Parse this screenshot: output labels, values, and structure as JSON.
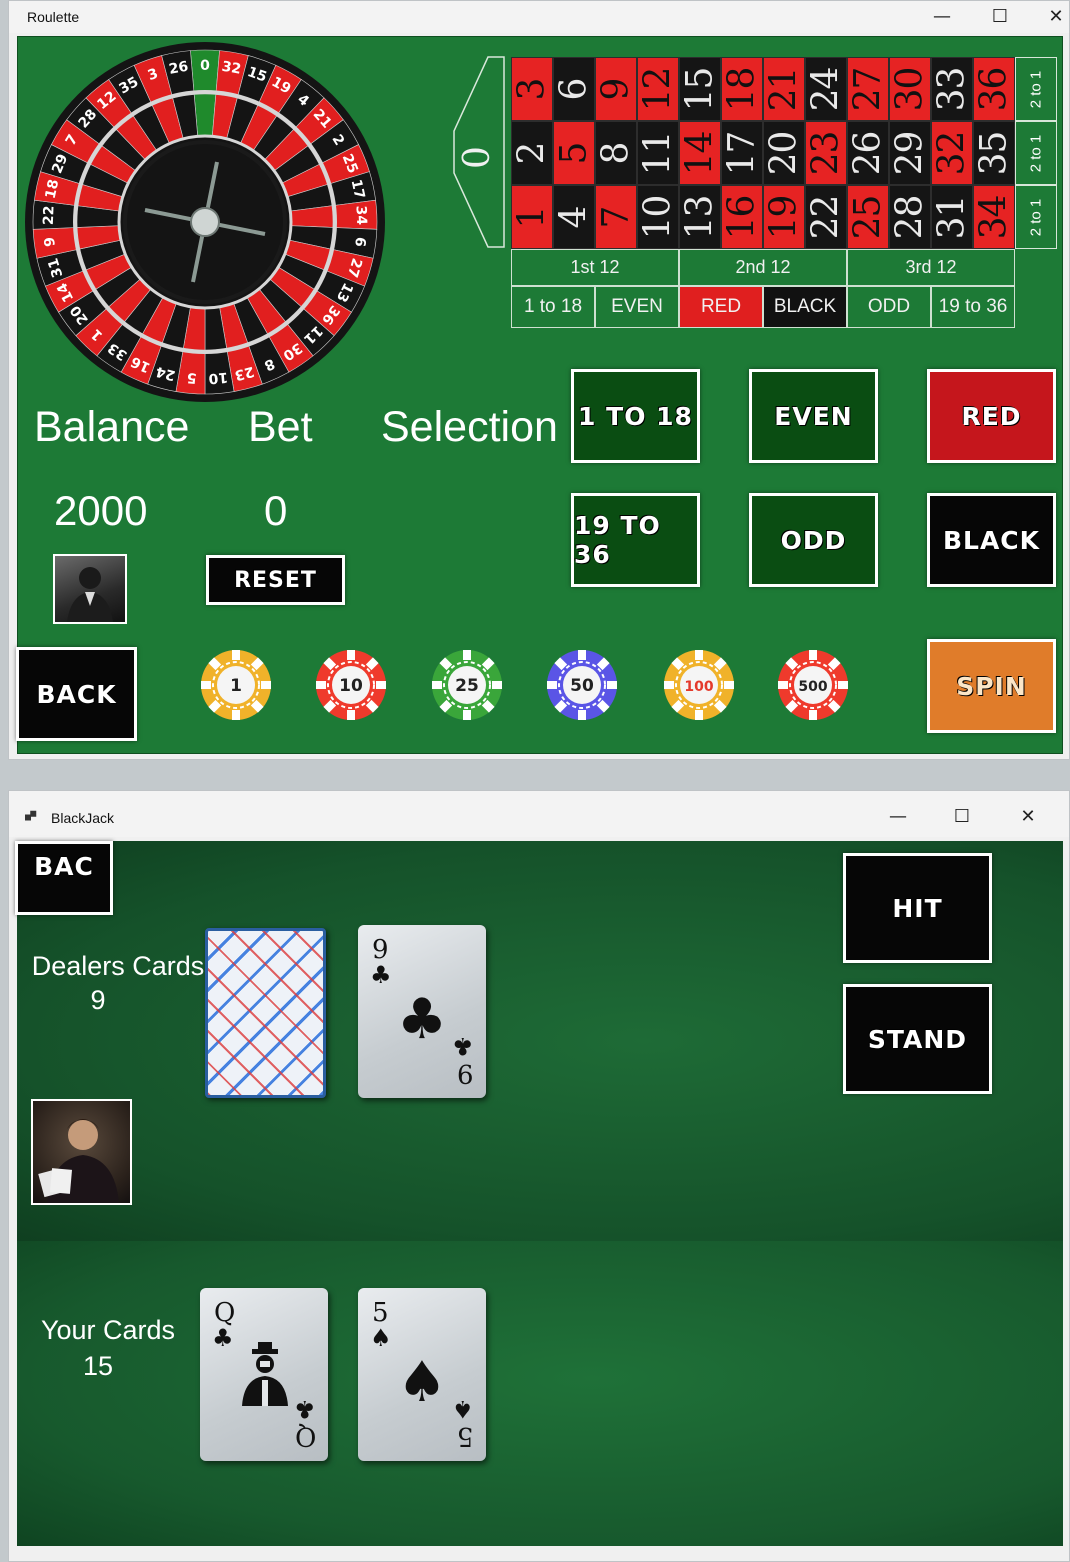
{
  "roulette": {
    "window_title": "Roulette",
    "controls": {
      "minimize": "—",
      "maximize": "☐",
      "close": "✕"
    },
    "wheel_numbers": [
      "0",
      "32",
      "15",
      "19",
      "4",
      "21",
      "2",
      "25",
      "17",
      "34",
      "6",
      "27",
      "13",
      "36",
      "11",
      "30",
      "8",
      "23",
      "10",
      "5",
      "24",
      "16",
      "33",
      "1",
      "20",
      "14",
      "31",
      "9",
      "22",
      "18",
      "29",
      "7",
      "28",
      "12",
      "35",
      "3",
      "26"
    ],
    "table": {
      "zero": "0",
      "top_row": [
        "3",
        "6",
        "9",
        "12",
        "15",
        "18",
        "21",
        "24",
        "27",
        "30",
        "33",
        "36"
      ],
      "mid_row": [
        "2",
        "5",
        "8",
        "11",
        "14",
        "17",
        "20",
        "23",
        "26",
        "29",
        "32",
        "35"
      ],
      "bottom_row": [
        "1",
        "4",
        "7",
        "10",
        "13",
        "16",
        "19",
        "22",
        "25",
        "28",
        "31",
        "34"
      ],
      "columns": [
        "2 to 1",
        "2 to 1",
        "2 to 1"
      ],
      "dozens": [
        "1st 12",
        "2nd 12",
        "3rd 12"
      ],
      "outside": [
        "1 to 18",
        "EVEN",
        "RED",
        "BLACK",
        "ODD",
        "19 to 36"
      ]
    },
    "labels": {
      "balance": "Balance",
      "bet": "Bet",
      "selection": "Selection"
    },
    "values": {
      "balance": "2000",
      "bet": "0"
    },
    "buttons": {
      "low": "1 TO 18",
      "even": "EVEN",
      "red": "RED",
      "high": "19 TO 36",
      "odd": "ODD",
      "black": "BLACK",
      "reset": "RESET",
      "back": "BACK",
      "spin": "SPIN"
    },
    "chips": [
      "1",
      "10",
      "25",
      "50",
      "100",
      "500"
    ]
  },
  "blackjack": {
    "window_title": "BlackJack",
    "controls": {
      "minimize": "—",
      "maximize": "☐",
      "close": "✕"
    },
    "buttons": {
      "back": "BAC",
      "hit": "HIT",
      "stand": "STAND"
    },
    "dealer": {
      "label": "Dealers Cards",
      "total": "9",
      "cards": [
        {
          "rank": "9",
          "suit": "♣"
        }
      ]
    },
    "player": {
      "label": "Your Cards",
      "total": "15",
      "cards": [
        {
          "rank": "Q",
          "suit": "♣"
        },
        {
          "rank": "5",
          "suit": "♠"
        }
      ]
    }
  }
}
